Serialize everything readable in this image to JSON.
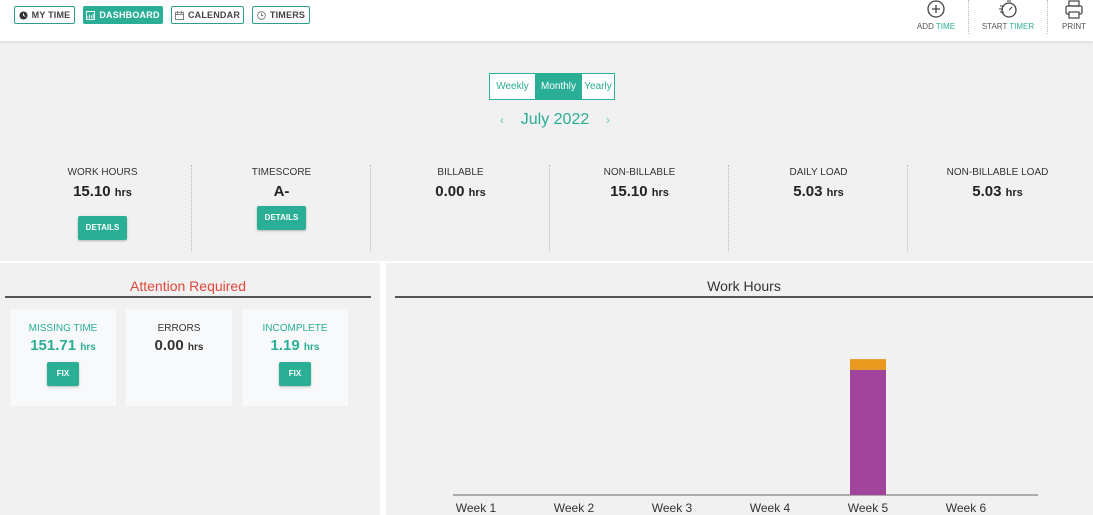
{
  "nav": {
    "my_time": "MY TIME",
    "dashboard": "DASHBOARD",
    "calendar": "CALENDAR",
    "timers": "TIMERS"
  },
  "actions": {
    "add_time_a": "ADD ",
    "add_time_b": "TIME",
    "start_timer_a": "START ",
    "start_timer_b": "TIMER",
    "print": "PRINT"
  },
  "period": {
    "options": [
      "Weekly",
      "Monthly",
      "Yearly"
    ],
    "selected": "Monthly",
    "month_label": "July 2022",
    "prev": "‹",
    "next": "›"
  },
  "stats": [
    {
      "title": "WORK HOURS",
      "value": "15.10",
      "unit": "hrs",
      "button": "DETAILS"
    },
    {
      "title": "TIMESCORE",
      "value": "A-",
      "unit": "",
      "button": "DETAILS"
    },
    {
      "title": "BILLABLE",
      "value": "0.00",
      "unit": "hrs"
    },
    {
      "title": "NON-BILLABLE",
      "value": "15.10",
      "unit": "hrs"
    },
    {
      "title": "DAILY LOAD",
      "value": "5.03",
      "unit": "hrs"
    },
    {
      "title": "NON-BILLABLE LOAD",
      "value": "5.03",
      "unit": "hrs"
    }
  ],
  "attention": {
    "title": "Attention Required",
    "cards": [
      {
        "title": "MISSING TIME",
        "value": "151.71",
        "unit": "hrs",
        "button": "FIX"
      },
      {
        "title": "ERRORS",
        "value": "0.00",
        "unit": "hrs"
      },
      {
        "title": "INCOMPLETE",
        "value": "1.19",
        "unit": "hrs",
        "button": "FIX"
      }
    ]
  },
  "colors": {
    "accent": "#2aae95",
    "alert": "#e0473b",
    "bar_purple": "#a0449c",
    "bar_orange": "#e99a1f"
  },
  "chart_title": "Work Hours",
  "chart_data": {
    "type": "bar",
    "stacked": true,
    "title": "Work Hours",
    "categories": [
      "Week 1",
      "Week 2",
      "Week 3",
      "Week 4",
      "Week 5",
      "Week 6"
    ],
    "series": [
      {
        "values": [
          0,
          0,
          0,
          0,
          13.9
        ],
        "color": "#a0449c"
      },
      {
        "values": [
          0,
          0,
          0,
          0,
          1.2
        ],
        "color": "#e99a1f"
      }
    ],
    "ylim": [
      0,
      20
    ],
    "grid": false
  }
}
